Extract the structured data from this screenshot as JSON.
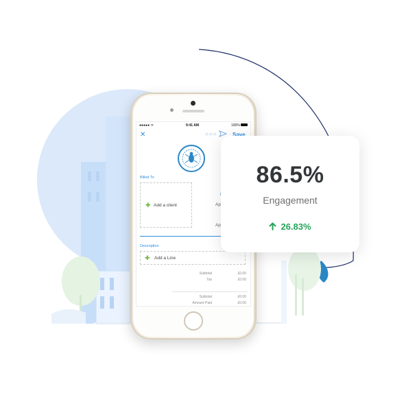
{
  "phone_app": {
    "status_bar": {
      "signal": "●●●●● ᯤ",
      "time": "9:41 AM",
      "battery_pct": "100%"
    },
    "nav": {
      "close_icon": "close-icon",
      "more_icon": "more-icon",
      "send_icon": "send-icon",
      "save_label": "Save"
    },
    "billed_to_label": "Billed To",
    "add_client_label": "Add a client",
    "side_label": "D",
    "side_date_1": "Apr",
    "side_date_2": "Apr",
    "description_label": "Description",
    "add_line_label": "Add a Line",
    "summary": [
      {
        "label": "Subtotal",
        "value": "£0.00"
      },
      {
        "label": "Tax",
        "value": "£0.00"
      },
      {
        "label": "Subtotal",
        "value": "£0.00"
      },
      {
        "label": "Amount Paid",
        "value": "£0.00"
      }
    ]
  },
  "card": {
    "value": "86.5%",
    "label": "Engagement",
    "change": "26.83%",
    "change_icon": "arrow-up-icon"
  },
  "colors": {
    "accent_blue": "#2c8de0",
    "positive_green": "#25a35a",
    "plus_green": "#67b83a",
    "bg_circle": "#dbe9fa",
    "arc_navy": "#1f2f6b"
  }
}
